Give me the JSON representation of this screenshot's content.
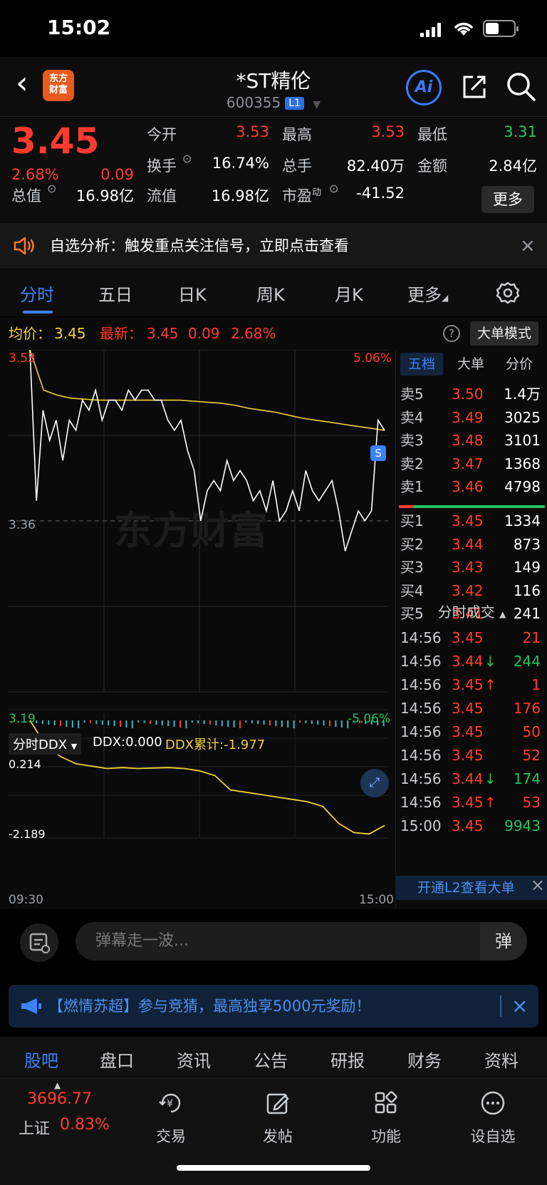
{
  "status": {
    "time": "15:02"
  },
  "header": {
    "back": "‹",
    "logo_text_1": "东方",
    "logo_text_2": "财富",
    "title": "*ST精伦",
    "code": "600355",
    "level_badge": "L1",
    "ai_label": "Ai"
  },
  "quote": {
    "price": "3.45",
    "change_pct": "2.68%",
    "change": "0.09",
    "open_label": "今开",
    "open": "3.53",
    "high_label": "最高",
    "high": "3.53",
    "low_label": "最低",
    "low": "3.31",
    "turnover_label": "换手",
    "turnover": "16.74%",
    "volume_label": "总手",
    "volume": "82.40万",
    "amount_label": "金额",
    "amount": "2.84亿",
    "mktcap_label": "总值",
    "mktcap": "16.98亿",
    "float_label": "流值",
    "float": "16.98亿",
    "pe_label": "市盈",
    "pe_sup": "动",
    "pe": "-41.52",
    "more_label": "更多"
  },
  "notice": {
    "text": "自选分析：触发重点关注信号，立即点击查看",
    "close": "×"
  },
  "tabs": [
    "分时",
    "五日",
    "日K",
    "周K",
    "月K",
    "更多"
  ],
  "avg_row": {
    "avg_label": "均价：",
    "avg": "3.45",
    "latest_label": "最新：",
    "latest": "3.45",
    "latest_chg": "0.09",
    "latest_pct": "2.68%",
    "help": "?",
    "big_order_mode": "大单模式"
  },
  "chart": {
    "y_top": "3.53",
    "y_mid": "3.36",
    "y_bottom": "3.19",
    "pct_top": "5.06%",
    "pct_bottom": "-5.06%",
    "watermark": "东方财富",
    "marker": "S",
    "ddx_selector": "分时DDX",
    "ddx_label": "DDX:0.000",
    "ddx_cum_label": "DDX累计:-1.977",
    "ddx_top": "0.214",
    "ddx_bottom": "-2.189",
    "time_start": "09:30",
    "time_end": "15:00"
  },
  "chart_data": {
    "type": "line",
    "title": "",
    "ylim": [
      3.19,
      3.53
    ],
    "series": [
      {
        "name": "",
        "values": [
          3.53,
          3.38,
          3.47,
          3.44,
          3.46,
          3.42,
          3.46,
          3.45,
          3.48,
          3.47,
          3.49,
          3.46,
          3.48,
          3.48,
          3.47,
          3.49,
          3.48,
          3.49,
          3.49,
          3.48,
          3.48,
          3.46,
          3.45,
          3.46,
          3.43,
          3.41,
          3.36,
          3.39,
          3.4,
          3.39,
          3.42,
          3.4,
          3.41,
          3.4,
          3.38,
          3.39,
          3.37,
          3.4,
          3.36,
          3.37,
          3.39,
          3.37,
          3.41,
          3.39,
          3.38,
          3.39,
          3.4,
          3.37,
          3.33,
          3.35,
          3.37,
          3.36,
          3.37,
          3.46,
          3.45
        ]
      },
      {
        "name": "均价",
        "values": [
          3.53,
          3.49,
          3.485,
          3.482,
          3.481,
          3.48,
          3.48,
          3.48,
          3.48,
          3.48,
          3.48,
          3.48,
          3.479,
          3.478,
          3.477,
          3.475,
          3.472,
          3.47,
          3.468,
          3.465,
          3.462,
          3.46,
          3.458,
          3.456,
          3.454,
          3.452,
          3.45
        ]
      }
    ]
  },
  "ddx_chart": {
    "values": [
      0.214,
      -0.3,
      -0.55,
      -0.7,
      -0.75,
      -0.8,
      -0.78,
      -0.8,
      -0.79,
      -0.78,
      -0.8,
      -0.85,
      -0.95,
      -1.25,
      -1.3,
      -1.35,
      -1.4,
      -1.45,
      -1.5,
      -1.6,
      -1.95,
      -2.15,
      -2.18,
      -2.0
    ]
  },
  "book": {
    "tabs": [
      "五档",
      "大单",
      "分价"
    ],
    "asks": [
      {
        "label": "卖5",
        "price": "3.50",
        "vol": "1.4万"
      },
      {
        "label": "卖4",
        "price": "3.49",
        "vol": "3025"
      },
      {
        "label": "卖3",
        "price": "3.48",
        "vol": "3101"
      },
      {
        "label": "卖2",
        "price": "3.47",
        "vol": "1368"
      },
      {
        "label": "卖1",
        "price": "3.46",
        "vol": "4798"
      }
    ],
    "bids": [
      {
        "label": "买1",
        "price": "3.45",
        "vol": "1334"
      },
      {
        "label": "买2",
        "price": "3.44",
        "vol": "873"
      },
      {
        "label": "买3",
        "price": "3.43",
        "vol": "149"
      },
      {
        "label": "买4",
        "price": "3.42",
        "vol": "116"
      },
      {
        "label": "买5",
        "price": "3.41",
        "vol": "241"
      }
    ],
    "trades_title": "分时成交",
    "trades": [
      {
        "time": "14:56",
        "price": "3.45",
        "dir": "",
        "vol": "21",
        "color": "red"
      },
      {
        "time": "14:56",
        "price": "3.44",
        "dir": "↓",
        "vol": "244",
        "color": "green"
      },
      {
        "time": "14:56",
        "price": "3.45",
        "dir": "↑",
        "vol": "1",
        "color": "red"
      },
      {
        "time": "14:56",
        "price": "3.45",
        "dir": "",
        "vol": "176",
        "color": "red"
      },
      {
        "time": "14:56",
        "price": "3.45",
        "dir": "",
        "vol": "50",
        "color": "red"
      },
      {
        "time": "14:56",
        "price": "3.45",
        "dir": "",
        "vol": "52",
        "color": "red"
      },
      {
        "time": "14:56",
        "price": "3.44",
        "dir": "↓",
        "vol": "174",
        "color": "green"
      },
      {
        "time": "14:56",
        "price": "3.45",
        "dir": "↑",
        "vol": "53",
        "color": "red"
      },
      {
        "time": "15:00",
        "price": "3.45",
        "dir": "",
        "vol": "9943",
        "color": "green"
      }
    ],
    "l2_banner": "开通L2查看大单",
    "l2_close": "×"
  },
  "comment": {
    "placeholder": "弹幕走一波...",
    "barrage_btn": "弹"
  },
  "promo": {
    "text": "【燃情苏超】参与竞猜，最高独享5000元奖励！",
    "close": "×"
  },
  "sub_tabs": [
    "股吧",
    "盘口",
    "资讯",
    "公告",
    "研报",
    "财务",
    "资料"
  ],
  "bottom_nav": {
    "index_value": "3696.77",
    "index_name": "上证",
    "index_pct": "0.83%",
    "items": [
      "交易",
      "发帖",
      "功能",
      "设自选"
    ]
  }
}
